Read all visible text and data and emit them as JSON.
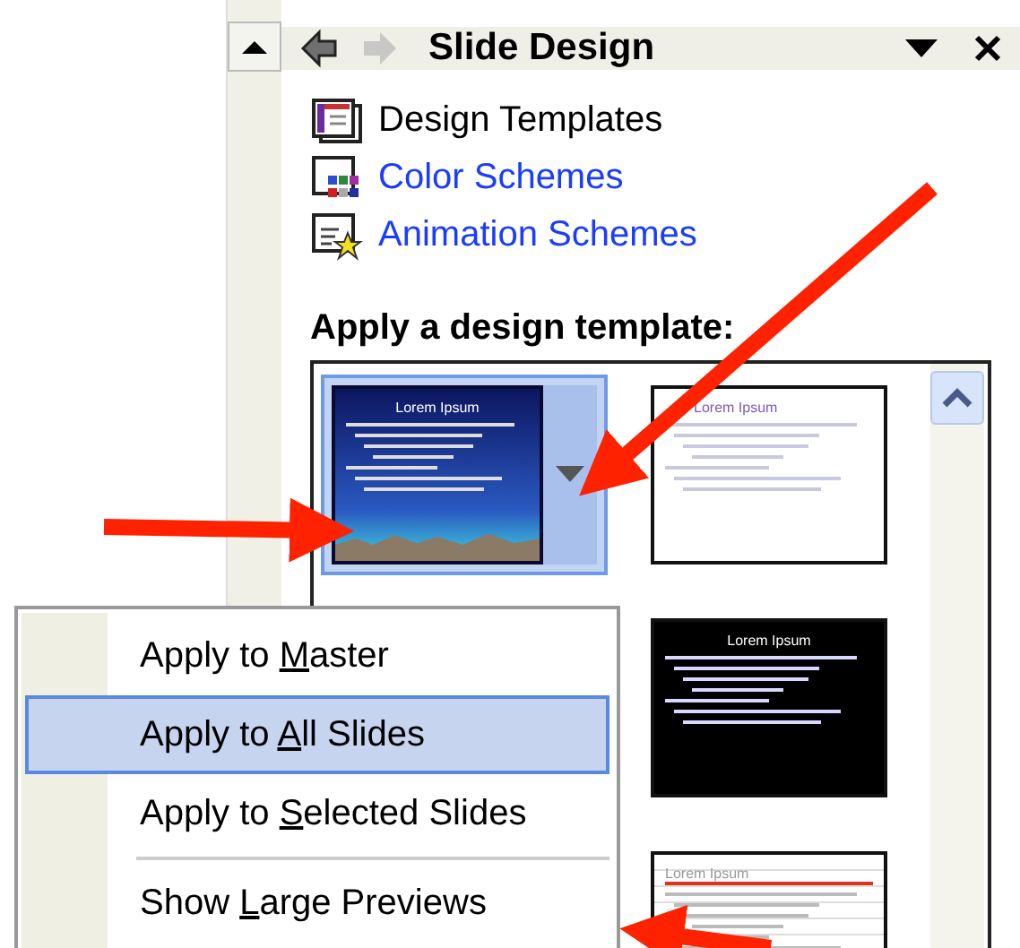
{
  "task_pane": {
    "title": "Slide Design",
    "back_disabled": false,
    "forward_disabled": true,
    "links": [
      {
        "kind": "templates",
        "label": "Design Templates",
        "active": true
      },
      {
        "kind": "colors",
        "label": "Color Schemes",
        "active": false
      },
      {
        "kind": "animation",
        "label": "Animation Schemes",
        "active": false
      }
    ],
    "section_heading": "Apply a design template:",
    "template_columns": [
      [
        {
          "kind": "night",
          "title": "Lorem Ipsum",
          "selected": true
        }
      ],
      [
        {
          "kind": "white",
          "title": "Lorem Ipsum",
          "selected": false
        },
        {
          "kind": "black",
          "title": "Lorem Ipsum",
          "selected": false
        },
        {
          "kind": "redline",
          "title": "Lorem Ipsum",
          "selected": false
        }
      ]
    ]
  },
  "context_menu": [
    {
      "kind": "item",
      "pre": "Apply to ",
      "key": "M",
      "post": "aster",
      "selected": false
    },
    {
      "kind": "item",
      "pre": "Apply to ",
      "key": "A",
      "post": "ll Slides",
      "selected": true
    },
    {
      "kind": "item",
      "pre": "Apply to ",
      "key": "S",
      "post": "elected Slides",
      "selected": false
    },
    {
      "kind": "separator"
    },
    {
      "kind": "item",
      "pre": "Show ",
      "key": "L",
      "post": "arge Previews",
      "selected": false
    }
  ]
}
